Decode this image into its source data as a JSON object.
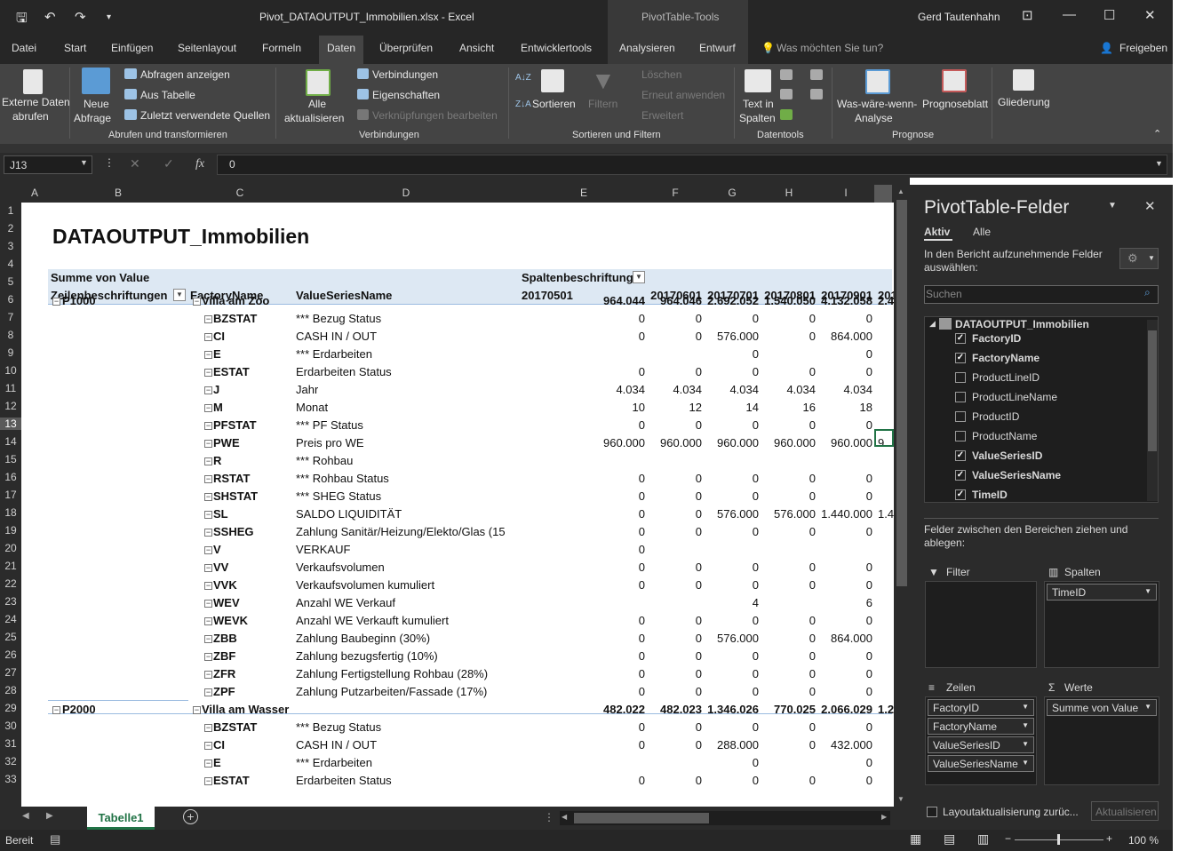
{
  "window": {
    "title": "Pivot_DATAOUTPUT_Immobilien.xlsx  -  Excel",
    "context_tools": "PivotTable-Tools",
    "user": "Gerd Tautenhahn"
  },
  "tabs": [
    "Datei",
    "Start",
    "Einfügen",
    "Seitenlayout",
    "Formeln",
    "Daten",
    "Überprüfen",
    "Ansicht",
    "Entwicklertools",
    "Analysieren",
    "Entwurf"
  ],
  "tell_me": "Was möchten Sie tun?",
  "share": "Freigeben",
  "ribbon": {
    "externe1": "Externe Daten",
    "externe2": "abrufen",
    "neue1": "Neue",
    "neue2": "Abfrage",
    "abfragen_anzeigen": "Abfragen anzeigen",
    "aus_tabelle": "Aus Tabelle",
    "zuletzt": "Zuletzt verwendete Quellen",
    "group1": "Abrufen und transformieren",
    "alle1": "Alle",
    "alle2": "aktualisieren",
    "verbindungen": "Verbindungen",
    "eigenschaften": "Eigenschaften",
    "verknuepfungen": "Verknüpfungen bearbeiten",
    "group2": "Verbindungen",
    "sortieren": "Sortieren",
    "filtern": "Filtern",
    "loeschen": "Löschen",
    "erneut": "Erneut anwenden",
    "erweitert": "Erweitert",
    "group3": "Sortieren und Filtern",
    "text1": "Text in",
    "text2": "Spalten",
    "group4": "Datentools",
    "was1": "Was-wäre-wenn-",
    "was2": "Analyse",
    "prognose": "Prognoseblatt",
    "group5": "Prognose",
    "gliederung": "Gliederung"
  },
  "formula_bar": {
    "name_box": "J13",
    "fx": "fx",
    "value": "0"
  },
  "columns": [
    "A",
    "B",
    "C",
    "D",
    "E",
    "F",
    "G",
    "H",
    "I"
  ],
  "rows": [
    "1",
    "2",
    "3",
    "4",
    "5",
    "6",
    "7",
    "8",
    "9",
    "10",
    "11",
    "12",
    "13",
    "14",
    "15",
    "16",
    "17",
    "18",
    "19",
    "20",
    "21",
    "22",
    "23",
    "24",
    "25",
    "26",
    "27",
    "28",
    "29",
    "30",
    "31",
    "32",
    "33"
  ],
  "pivot": {
    "title": "DATAOUTPUT_Immobilien",
    "summe": "Summe von Value",
    "spalten": "Spaltenbeschriftung",
    "zeilen": "Zeilenbeschriftungen",
    "factory_name_hdr": "FactoryName",
    "vsn_hdr": "ValueSeriesName",
    "dates": [
      "20170501",
      "20170601",
      "20170701",
      "20170801",
      "20170901",
      "201"
    ],
    "rows": [
      {
        "r": 6,
        "b": "P1000",
        "c": "Villa am Zoo",
        "d": "",
        "v": [
          "964.044",
          "964.046",
          "2.692.052",
          "1.540.050",
          "4.132.058",
          "2.4"
        ],
        "bold": true
      },
      {
        "r": 7,
        "c": "BZSTAT",
        "d": "*** Bezug Status",
        "v": [
          "0",
          "0",
          "0",
          "0",
          "0",
          ""
        ]
      },
      {
        "r": 8,
        "c": "CI",
        "d": "CASH IN / OUT",
        "v": [
          "0",
          "0",
          "576.000",
          "0",
          "864.000",
          ""
        ]
      },
      {
        "r": 9,
        "c": "E",
        "d": "*** Erdarbeiten",
        "v": [
          "",
          "",
          "0",
          "",
          "0",
          ""
        ]
      },
      {
        "r": 10,
        "c": "ESTAT",
        "d": "Erdarbeiten Status",
        "v": [
          "0",
          "0",
          "0",
          "0",
          "0",
          ""
        ]
      },
      {
        "r": 11,
        "c": "J",
        "d": "Jahr",
        "v": [
          "4.034",
          "4.034",
          "4.034",
          "4.034",
          "4.034",
          ""
        ]
      },
      {
        "r": 12,
        "c": "M",
        "d": "Monat",
        "v": [
          "10",
          "12",
          "14",
          "16",
          "18",
          ""
        ]
      },
      {
        "r": 13,
        "c": "PFSTAT",
        "d": "*** PF Status",
        "v": [
          "0",
          "0",
          "0",
          "0",
          "0",
          ""
        ]
      },
      {
        "r": 14,
        "c": "PWE",
        "d": "Preis pro WE",
        "v": [
          "960.000",
          "960.000",
          "960.000",
          "960.000",
          "960.000",
          "9"
        ]
      },
      {
        "r": 15,
        "c": "R",
        "d": "*** Rohbau",
        "v": [
          "",
          "",
          "",
          "",
          "",
          ""
        ]
      },
      {
        "r": 16,
        "c": "RSTAT",
        "d": "*** Rohbau Status",
        "v": [
          "0",
          "0",
          "0",
          "0",
          "0",
          ""
        ]
      },
      {
        "r": 17,
        "c": "SHSTAT",
        "d": "*** SHEG Status",
        "v": [
          "0",
          "0",
          "0",
          "0",
          "0",
          ""
        ]
      },
      {
        "r": 18,
        "c": "SL",
        "d": "SALDO LIQUIDITÄT",
        "v": [
          "0",
          "0",
          "576.000",
          "576.000",
          "1.440.000",
          "1.4"
        ]
      },
      {
        "r": 19,
        "c": "SSHEG",
        "d": "Zahlung Sanitär/Heizung/Elekto/Glas (15",
        "v": [
          "0",
          "0",
          "0",
          "0",
          "0",
          ""
        ]
      },
      {
        "r": 20,
        "c": "V",
        "d": "VERKAUF",
        "v": [
          "0",
          "",
          "",
          "",
          "",
          ""
        ]
      },
      {
        "r": 21,
        "c": "VV",
        "d": "Verkaufsvolumen",
        "v": [
          "0",
          "0",
          "0",
          "0",
          "0",
          ""
        ]
      },
      {
        "r": 22,
        "c": "VVK",
        "d": "Verkaufsvolumen kumuliert",
        "v": [
          "0",
          "0",
          "0",
          "0",
          "0",
          ""
        ]
      },
      {
        "r": 23,
        "c": "WEV",
        "d": "Anzahl WE Verkauf",
        "v": [
          "",
          "",
          "4",
          "",
          "6",
          ""
        ]
      },
      {
        "r": 24,
        "c": "WEVK",
        "d": "Anzahl WE Verkauft kumuliert",
        "v": [
          "0",
          "0",
          "0",
          "0",
          "0",
          ""
        ]
      },
      {
        "r": 25,
        "c": "ZBB",
        "d": "Zahlung Baubeginn (30%)",
        "v": [
          "0",
          "0",
          "576.000",
          "0",
          "864.000",
          ""
        ]
      },
      {
        "r": 26,
        "c": "ZBF",
        "d": "Zahlung bezugsfertig (10%)",
        "v": [
          "0",
          "0",
          "0",
          "0",
          "0",
          ""
        ]
      },
      {
        "r": 27,
        "c": "ZFR",
        "d": "Zahlung Fertigstellung Rohbau (28%)",
        "v": [
          "0",
          "0",
          "0",
          "0",
          "0",
          ""
        ]
      },
      {
        "r": 28,
        "c": "ZPF",
        "d": "Zahlung Putzarbeiten/Fassade (17%)",
        "v": [
          "0",
          "0",
          "0",
          "0",
          "0",
          ""
        ]
      },
      {
        "r": 29,
        "b": "P2000",
        "c": "Villa am Wasser",
        "d": "",
        "v": [
          "482.022",
          "482.023",
          "1.346.026",
          "770.025",
          "2.066.029",
          "1.2"
        ],
        "bold": true
      },
      {
        "r": 30,
        "c": "BZSTAT",
        "d": "*** Bezug Status",
        "v": [
          "0",
          "0",
          "0",
          "0",
          "0",
          ""
        ]
      },
      {
        "r": 31,
        "c": "CI",
        "d": "CASH IN / OUT",
        "v": [
          "0",
          "0",
          "288.000",
          "0",
          "432.000",
          ""
        ]
      },
      {
        "r": 32,
        "c": "E",
        "d": "*** Erdarbeiten",
        "v": [
          "",
          "",
          "0",
          "",
          "0",
          ""
        ]
      },
      {
        "r": 33,
        "c": "ESTAT",
        "d": "Erdarbeiten Status",
        "v": [
          "0",
          "0",
          "0",
          "0",
          "0",
          ""
        ]
      }
    ]
  },
  "sheet_tab": "Tabelle1",
  "status": {
    "ready": "Bereit",
    "zoom": "100 %"
  },
  "pane": {
    "title": "PivotTable-Felder",
    "tab_active": "Aktiv",
    "tab_all": "Alle",
    "instruction": "In den Bericht aufzunehmende Felder auswählen:",
    "search_placeholder": "Suchen",
    "table_name": "DATAOUTPUT_Immobilien",
    "fields": [
      {
        "name": "FactoryID",
        "checked": true
      },
      {
        "name": "FactoryName",
        "checked": true
      },
      {
        "name": "ProductLineID",
        "checked": false
      },
      {
        "name": "ProductLineName",
        "checked": false
      },
      {
        "name": "ProductID",
        "checked": false
      },
      {
        "name": "ProductName",
        "checked": false
      },
      {
        "name": "ValueSeriesID",
        "checked": true
      },
      {
        "name": "ValueSeriesName",
        "checked": true
      },
      {
        "name": "TimeID",
        "checked": true
      }
    ],
    "drag_text": "Felder zwischen den Bereichen ziehen und ablegen:",
    "filter": "Filter",
    "spalten": "Spalten",
    "zeilen": "Zeilen",
    "werte": "Werte",
    "spalten_items": [
      "TimeID"
    ],
    "zeilen_items": [
      "FactoryID",
      "FactoryName",
      "ValueSeriesID",
      "ValueSeriesName"
    ],
    "werte_items": [
      "Summe von Value"
    ],
    "defer": "Layoutaktualisierung zurüc...",
    "update": "Aktualisieren"
  },
  "colors": {
    "accent": "#217346",
    "header_band": "#dde8f3"
  }
}
